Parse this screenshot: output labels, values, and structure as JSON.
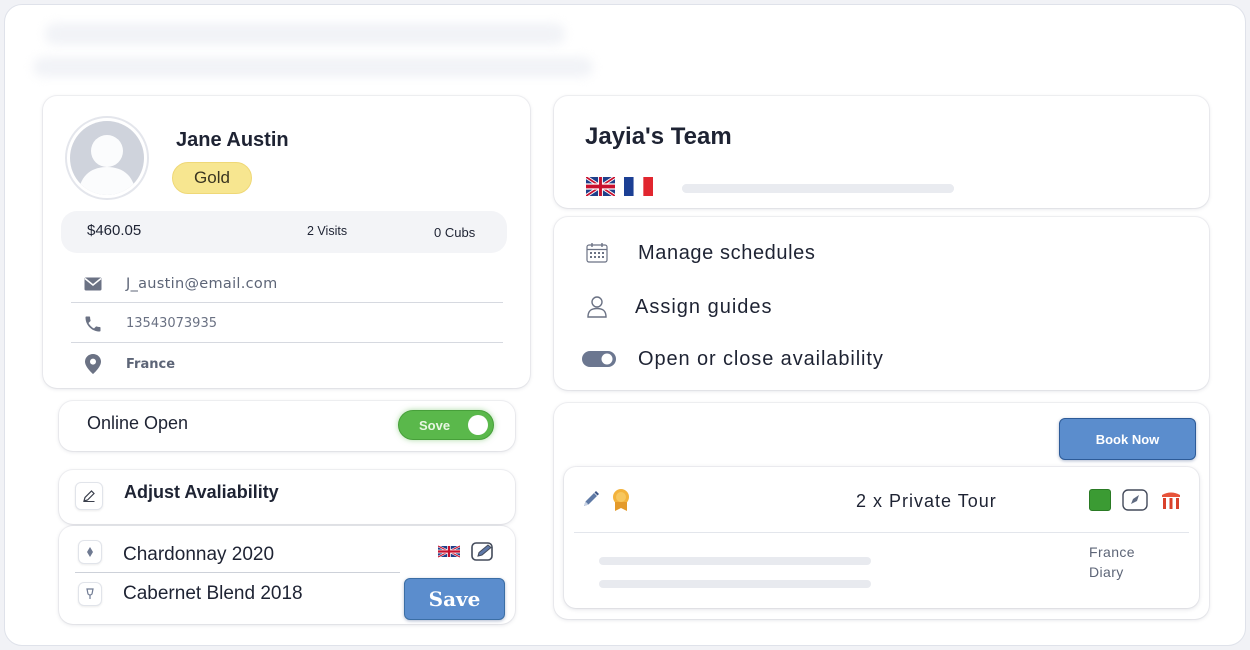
{
  "profile": {
    "name": "Jane Austin",
    "tier": "Gold",
    "stats": {
      "balance": "$460.05",
      "visits": "2 Visits",
      "cubs": "0 Cubs"
    },
    "contacts": [
      {
        "icon": "mail-icon",
        "text": "J_austin@email.com"
      },
      {
        "icon": "phone-icon",
        "text": "13543073935"
      },
      {
        "icon": "location-pin-icon",
        "text": "France"
      }
    ]
  },
  "online": {
    "label": "Online Open",
    "toggle_label": "Sove",
    "toggle_on": true,
    "toggle_color": "#5ab84b"
  },
  "availability": {
    "title": "Adjust Avaliability",
    "wines": [
      {
        "name": "Chardonnay 2020"
      },
      {
        "name": "Cabernet Blend 2018"
      }
    ],
    "save_label": "Save"
  },
  "team": {
    "title": "Jayia's Team",
    "flags": [
      "uk-flag-icon",
      "france-flag-icon"
    ],
    "progress_fraction": 1.0
  },
  "actions": [
    {
      "icon": "calendar-icon",
      "label": "Manage schedules"
    },
    {
      "icon": "user-icon",
      "label": "Assign guides"
    },
    {
      "icon": "toggle-icon",
      "label": "Open or close availability"
    }
  ],
  "booking": {
    "button_label": "Book Now",
    "tour_title": "2 x Private Tour",
    "meta": [
      "France",
      "Diary"
    ]
  },
  "colors": {
    "accent_blue": "#5b8dcd",
    "gold_badge": "#f7e690",
    "green": "#5ab84b"
  }
}
